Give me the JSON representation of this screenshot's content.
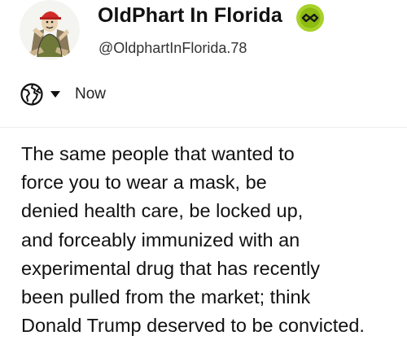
{
  "author": {
    "display_name": "OldPhart In Florida",
    "username": "@OldphartInFlorida.78",
    "avatar_icon": "cartoon-character-avatar",
    "verified_icon": "verified-badge-icon",
    "verified_color": "#a8d12a"
  },
  "meta": {
    "audience_icon": "globe-icon",
    "dropdown_icon": "caret-down-icon",
    "timestamp": "Now"
  },
  "post": {
    "lines": [
      "The same people that wanted to",
      "force you to wear a mask, be",
      "denied health care, be locked up,",
      "and forceably immunized with an",
      "experimental drug that has recently",
      "been pulled from the market; think",
      "Donald Trump deserved to be convicted."
    ]
  }
}
